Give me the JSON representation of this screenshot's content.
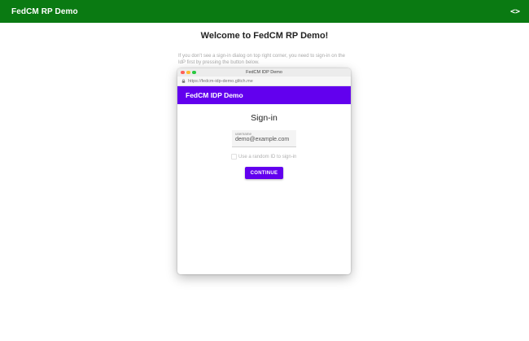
{
  "app": {
    "title": "FedCM RP Demo",
    "code_icon_text": "<>",
    "accent_color": "#0a7a12"
  },
  "main": {
    "welcome": "Welcome to FedCM RP Demo!",
    "instructions": "If you don't see a sign-in dialog on top right corner, you need to sign-in on the IdP first by pressing the button below."
  },
  "popup": {
    "window_title": "FedCM IDP Demo",
    "url": "https://fedcm-idp-demo.glitch.me",
    "header_title": "FedCM IDP Demo",
    "header_color": "#6200ee",
    "signin_title": "Sign-in",
    "username_label": "username",
    "username_value": "demo@example.com",
    "checkbox_label": "Use a random ID to sign-in",
    "continue_label": "CONTINUE",
    "traffic_lights": [
      "#fe5f57",
      "#febc2e",
      "#28c840"
    ]
  }
}
